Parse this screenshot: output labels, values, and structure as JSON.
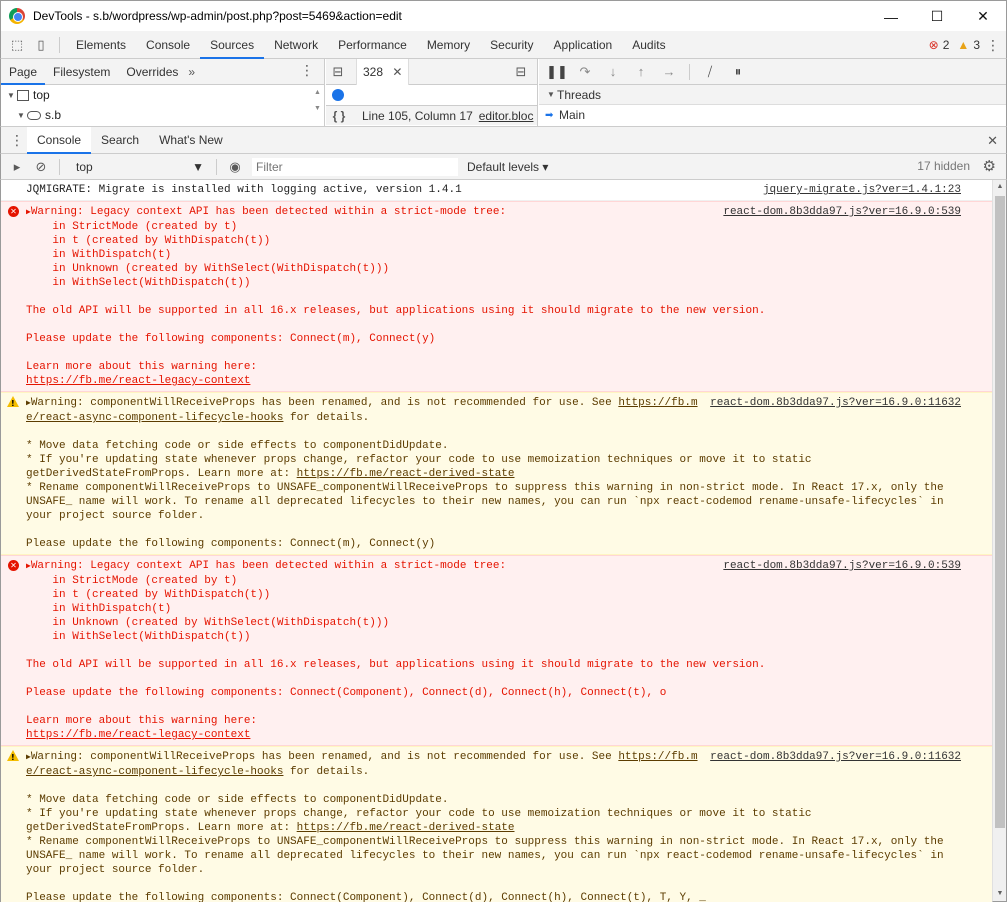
{
  "window": {
    "title": "DevTools - s.b/wordpress/wp-admin/post.php?post=5469&action=edit",
    "minimize": "—",
    "maximize": "☐",
    "close": "✕"
  },
  "toolbar": {
    "tabs": [
      "Elements",
      "Console",
      "Sources",
      "Network",
      "Performance",
      "Memory",
      "Security",
      "Application",
      "Audits"
    ],
    "active_tab": "Sources",
    "error_count": "2",
    "warning_count": "3"
  },
  "navigator": {
    "tabs": [
      "Page",
      "Filesystem",
      "Overrides"
    ],
    "more": "»",
    "tree": [
      "top",
      "s.b"
    ]
  },
  "editor": {
    "tab_label": "328",
    "position": "Line 105, Column 17",
    "file": "editor.bloc"
  },
  "debugger": {
    "threads_label": "Threads",
    "main_label": "Main"
  },
  "drawer": {
    "tabs": [
      "Console",
      "Search",
      "What's New"
    ],
    "active_tab": "Console"
  },
  "console_toolbar": {
    "context": "top",
    "filter_placeholder": "Filter",
    "levels": "Default levels ▾",
    "hidden": "17 hidden"
  },
  "messages": [
    {
      "level": "log",
      "text": "JQMIGRATE: Migrate is installed with logging active, version 1.4.1",
      "source": "jquery-migrate.js?ver=1.4.1:23"
    },
    {
      "level": "error",
      "head": "Warning: Legacy context API has been detected within a strict-mode tree:",
      "body": "    in StrictMode (created by t)\n    in t (created by WithDispatch(t))\n    in WithDispatch(t)\n    in Unknown (created by WithSelect(WithDispatch(t)))\n    in WithSelect(WithDispatch(t))\n\nThe old API will be supported in all 16.x releases, but applications using it should migrate to the new version.\n\nPlease update the following components: Connect(m), Connect(y)\n\nLearn more about this warning here:",
      "link": "https://fb.me/react-legacy-context",
      "source": "react-dom.8b3dda97.js?ver=16.9.0:539"
    },
    {
      "level": "warn",
      "head": "Warning: componentWillReceiveProps has been renamed, and is not recommended for use. See ",
      "head_link": "https://fb.m",
      "line2_link": "e/react-async-component-lifecycle-hooks",
      "line2_rest": " for details.",
      "body1": "\n* Move data fetching code or side effects to componentDidUpdate.\n* If you're updating state whenever props change, refactor your code to use memoization techniques or move it to static\ngetDerivedStateFromProps. Learn more at: ",
      "body1_link": "https://fb.me/react-derived-state",
      "body2": "\n* Rename componentWillReceiveProps to UNSAFE_componentWillReceiveProps to suppress this warning in non-strict mode. In React 17.x, only the\nUNSAFE_ name will work. To rename all deprecated lifecycles to their new names, you can run `npx react-codemod rename-unsafe-lifecycles` in\nyour project source folder.\n\nPlease update the following components: Connect(m), Connect(y)",
      "source": "react-dom.8b3dda97.js?ver=16.9.0:11632"
    },
    {
      "level": "error",
      "head": "Warning: Legacy context API has been detected within a strict-mode tree:",
      "body": "    in StrictMode (created by t)\n    in t (created by WithDispatch(t))\n    in WithDispatch(t)\n    in Unknown (created by WithSelect(WithDispatch(t)))\n    in WithSelect(WithDispatch(t))\n\nThe old API will be supported in all 16.x releases, but applications using it should migrate to the new version.\n\nPlease update the following components: Connect(Component), Connect(d), Connect(h), Connect(t), o\n\nLearn more about this warning here:",
      "link": "https://fb.me/react-legacy-context",
      "source": "react-dom.8b3dda97.js?ver=16.9.0:539"
    },
    {
      "level": "warn",
      "head": "Warning: componentWillReceiveProps has been renamed, and is not recommended for use. See ",
      "head_link": "https://fb.m",
      "line2_link": "e/react-async-component-lifecycle-hooks",
      "line2_rest": " for details.",
      "body1": "\n* Move data fetching code or side effects to componentDidUpdate.\n* If you're updating state whenever props change, refactor your code to use memoization techniques or move it to static\ngetDerivedStateFromProps. Learn more at: ",
      "body1_link": "https://fb.me/react-derived-state",
      "body2": "\n* Rename componentWillReceiveProps to UNSAFE_componentWillReceiveProps to suppress this warning in non-strict mode. In React 17.x, only the\nUNSAFE_ name will work. To rename all deprecated lifecycles to their new names, you can run `npx react-codemod rename-unsafe-lifecycles` in\nyour project source folder.\n\nPlease update the following components: Connect(Component), Connect(d), Connect(h), Connect(t), T, Y, _",
      "source": "react-dom.8b3dda97.js?ver=16.9.0:11632"
    }
  ]
}
